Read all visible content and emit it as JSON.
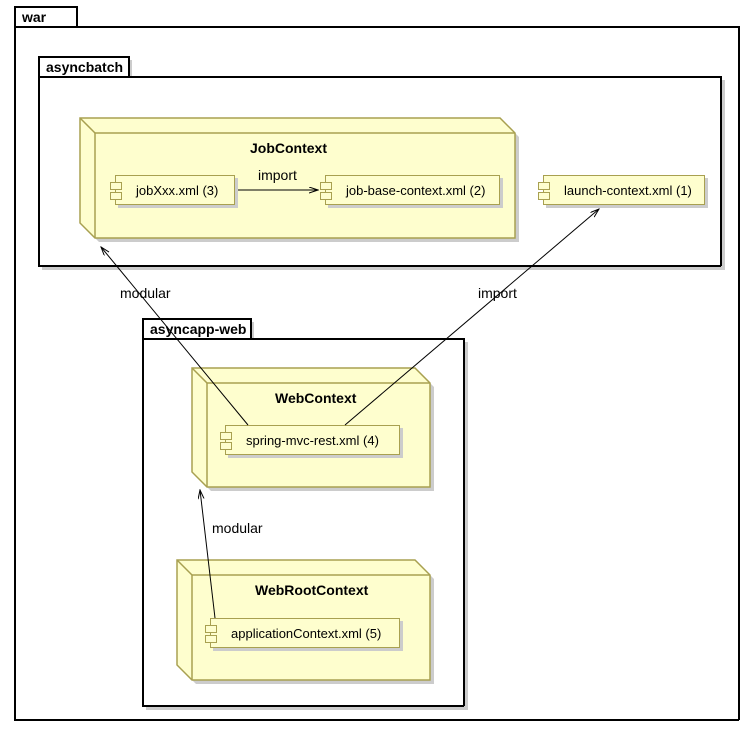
{
  "packages": {
    "war": "war",
    "asyncbatch": "asyncbatch",
    "asyncapp_web": "asyncapp-web"
  },
  "nodes": {
    "job_context": "JobContext",
    "web_context": "WebContext",
    "web_root_context": "WebRootContext"
  },
  "components": {
    "job_xxx": "jobXxx.xml (3)",
    "job_base": "job-base-context.xml (2)",
    "launch": "launch-context.xml (1)",
    "spring_mvc": "spring-mvc-rest.xml (4)",
    "app_ctx": "applicationContext.xml (5)"
  },
  "edges": {
    "import1": "import",
    "import2": "import",
    "modular1": "modular",
    "modular2": "modular"
  },
  "chart_data": {
    "type": "diagram",
    "diagram_type": "uml-package-component",
    "packages": [
      {
        "name": "war",
        "children": [
          {
            "name": "asyncbatch",
            "nodes": [
              {
                "name": "JobContext",
                "components": [
                  "jobXxx.xml (3)",
                  "job-base-context.xml (2)"
                ]
              }
            ],
            "components": [
              "launch-context.xml (1)"
            ]
          },
          {
            "name": "asyncapp-web",
            "nodes": [
              {
                "name": "WebContext",
                "components": [
                  "spring-mvc-rest.xml (4)"
                ]
              },
              {
                "name": "WebRootContext",
                "components": [
                  "applicationContext.xml (5)"
                ]
              }
            ]
          }
        ]
      }
    ],
    "relationships": [
      {
        "from": "jobXxx.xml (3)",
        "to": "job-base-context.xml (2)",
        "label": "import",
        "style": "arrow"
      },
      {
        "from": "spring-mvc-rest.xml (4)",
        "to": "launch-context.xml (1)",
        "label": "import",
        "style": "arrow"
      },
      {
        "from": "spring-mvc-rest.xml (4)",
        "to": "JobContext",
        "label": "modular",
        "style": "arrow"
      },
      {
        "from": "applicationContext.xml (5)",
        "to": "WebContext",
        "label": "modular",
        "style": "arrow"
      }
    ]
  }
}
